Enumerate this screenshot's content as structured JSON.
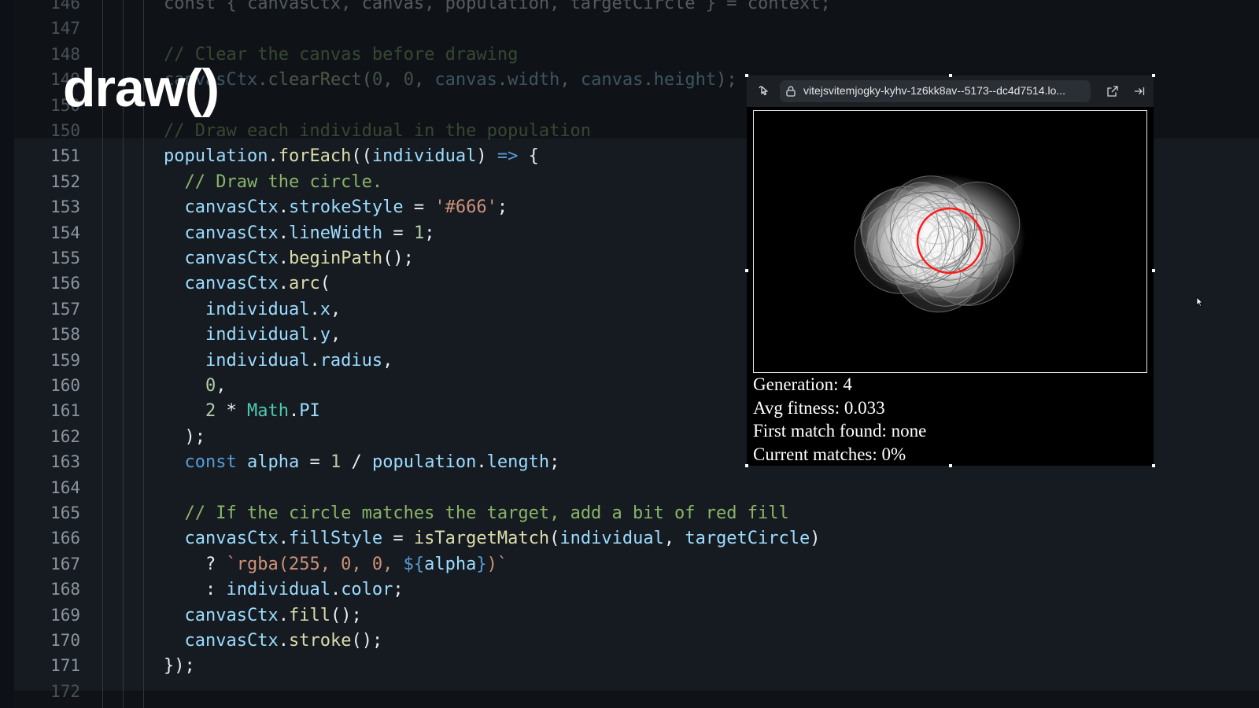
{
  "slide_title": "draw()",
  "editor": {
    "lines": [
      {
        "num": "146",
        "tokens": [
          [
            "p",
            "const { canvasCtx, canvas, population, targetCircle } = context;"
          ]
        ]
      },
      {
        "num": "147",
        "tokens": [
          [
            "p",
            ""
          ]
        ]
      },
      {
        "num": "148",
        "tokens": [
          [
            "com",
            "// Clear the canvas before drawing"
          ]
        ]
      },
      {
        "num": "149",
        "tokens": [
          [
            "id",
            "canvasCtx"
          ],
          [
            "p",
            "."
          ],
          [
            "fn",
            "clearRect"
          ],
          [
            "p",
            "("
          ],
          [
            "num",
            "0"
          ],
          [
            "p",
            ", "
          ],
          [
            "num",
            "0"
          ],
          [
            "p",
            ", "
          ],
          [
            "id",
            "canvas"
          ],
          [
            "p",
            "."
          ],
          [
            "id",
            "width"
          ],
          [
            "p",
            ", "
          ],
          [
            "id",
            "canvas"
          ],
          [
            "p",
            "."
          ],
          [
            "id",
            "height"
          ],
          [
            "p",
            ");"
          ]
        ]
      },
      {
        "num": "150",
        "tokens": [
          [
            "p",
            ""
          ]
        ]
      },
      {
        "num": "150",
        "tokens": [
          [
            "com",
            "// Draw each individual in the population"
          ]
        ]
      },
      {
        "num": "151",
        "tokens": [
          [
            "id",
            "population"
          ],
          [
            "p",
            "."
          ],
          [
            "fn",
            "forEach"
          ],
          [
            "p",
            "(("
          ],
          [
            "id",
            "individual"
          ],
          [
            "p",
            ") "
          ],
          [
            "kw",
            "=>"
          ],
          [
            "p",
            " {"
          ]
        ]
      },
      {
        "num": "152",
        "tokens": [
          [
            "p",
            "  "
          ],
          [
            "com",
            "// Draw the circle."
          ]
        ]
      },
      {
        "num": "153",
        "tokens": [
          [
            "p",
            "  "
          ],
          [
            "id",
            "canvasCtx"
          ],
          [
            "p",
            "."
          ],
          [
            "id",
            "strokeStyle"
          ],
          [
            "p",
            " = "
          ],
          [
            "str",
            "'#666'"
          ],
          [
            "p",
            ";"
          ]
        ]
      },
      {
        "num": "154",
        "tokens": [
          [
            "p",
            "  "
          ],
          [
            "id",
            "canvasCtx"
          ],
          [
            "p",
            "."
          ],
          [
            "id",
            "lineWidth"
          ],
          [
            "p",
            " = "
          ],
          [
            "num",
            "1"
          ],
          [
            "p",
            ";"
          ]
        ]
      },
      {
        "num": "155",
        "tokens": [
          [
            "p",
            "  "
          ],
          [
            "id",
            "canvasCtx"
          ],
          [
            "p",
            "."
          ],
          [
            "fn",
            "beginPath"
          ],
          [
            "p",
            "();"
          ]
        ]
      },
      {
        "num": "156",
        "tokens": [
          [
            "p",
            "  "
          ],
          [
            "id",
            "canvasCtx"
          ],
          [
            "p",
            "."
          ],
          [
            "fn",
            "arc"
          ],
          [
            "p",
            "("
          ]
        ]
      },
      {
        "num": "157",
        "tokens": [
          [
            "p",
            "    "
          ],
          [
            "id",
            "individual"
          ],
          [
            "p",
            "."
          ],
          [
            "id",
            "x"
          ],
          [
            "p",
            ","
          ]
        ]
      },
      {
        "num": "158",
        "tokens": [
          [
            "p",
            "    "
          ],
          [
            "id",
            "individual"
          ],
          [
            "p",
            "."
          ],
          [
            "id",
            "y"
          ],
          [
            "p",
            ","
          ]
        ]
      },
      {
        "num": "159",
        "tokens": [
          [
            "p",
            "    "
          ],
          [
            "id",
            "individual"
          ],
          [
            "p",
            "."
          ],
          [
            "id",
            "radius"
          ],
          [
            "p",
            ","
          ]
        ]
      },
      {
        "num": "160",
        "tokens": [
          [
            "p",
            "    "
          ],
          [
            "num",
            "0"
          ],
          [
            "p",
            ","
          ]
        ]
      },
      {
        "num": "161",
        "tokens": [
          [
            "p",
            "    "
          ],
          [
            "num",
            "2"
          ],
          [
            "p",
            " * "
          ],
          [
            "type",
            "Math"
          ],
          [
            "p",
            "."
          ],
          [
            "id",
            "PI"
          ]
        ]
      },
      {
        "num": "162",
        "tokens": [
          [
            "p",
            "  );"
          ]
        ]
      },
      {
        "num": "163",
        "tokens": [
          [
            "p",
            "  "
          ],
          [
            "kw",
            "const"
          ],
          [
            "p",
            " "
          ],
          [
            "id",
            "alpha"
          ],
          [
            "p",
            " = "
          ],
          [
            "num",
            "1"
          ],
          [
            "p",
            " / "
          ],
          [
            "id",
            "population"
          ],
          [
            "p",
            "."
          ],
          [
            "id",
            "length"
          ],
          [
            "p",
            ";"
          ]
        ]
      },
      {
        "num": "164",
        "tokens": [
          [
            "p",
            ""
          ]
        ]
      },
      {
        "num": "165",
        "tokens": [
          [
            "p",
            "  "
          ],
          [
            "com",
            "// If the circle matches the target, add a bit of red fill"
          ]
        ]
      },
      {
        "num": "166",
        "tokens": [
          [
            "p",
            "  "
          ],
          [
            "id",
            "canvasCtx"
          ],
          [
            "p",
            "."
          ],
          [
            "id",
            "fillStyle"
          ],
          [
            "p",
            " = "
          ],
          [
            "fn",
            "isTargetMatch"
          ],
          [
            "p",
            "("
          ],
          [
            "id",
            "individual"
          ],
          [
            "p",
            ", "
          ],
          [
            "id",
            "targetCircle"
          ],
          [
            "p",
            ")"
          ]
        ]
      },
      {
        "num": "167",
        "tokens": [
          [
            "p",
            "    ? "
          ],
          [
            "str",
            "`rgba(255, 0, 0, "
          ],
          [
            "kw",
            "${"
          ],
          [
            "id",
            "alpha"
          ],
          [
            "kw",
            "}"
          ],
          [
            "str",
            ")`"
          ]
        ]
      },
      {
        "num": "168",
        "tokens": [
          [
            "p",
            "    : "
          ],
          [
            "id",
            "individual"
          ],
          [
            "p",
            "."
          ],
          [
            "id",
            "color"
          ],
          [
            "p",
            ";"
          ]
        ]
      },
      {
        "num": "169",
        "tokens": [
          [
            "p",
            "  "
          ],
          [
            "id",
            "canvasCtx"
          ],
          [
            "p",
            "."
          ],
          [
            "fn",
            "fill"
          ],
          [
            "p",
            "();"
          ]
        ]
      },
      {
        "num": "170",
        "tokens": [
          [
            "p",
            "  "
          ],
          [
            "id",
            "canvasCtx"
          ],
          [
            "p",
            "."
          ],
          [
            "fn",
            "stroke"
          ],
          [
            "p",
            "();"
          ]
        ]
      },
      {
        "num": "171",
        "tokens": [
          [
            "p",
            "});"
          ]
        ]
      },
      {
        "num": "172",
        "tokens": [
          [
            "p",
            ""
          ]
        ]
      }
    ]
  },
  "preview": {
    "url": "vitejsvitemjogky-kyhv-1z6kk8av--5173--dc4d7514.lo...",
    "icons": {
      "left": "cursor-pointer-icon",
      "lock": "lock-icon",
      "open": "open-external-icon",
      "collapse": "collapse-right-icon"
    },
    "stats": {
      "generation": "Generation: 4",
      "avg_fitness": "Avg fitness: 0.033",
      "first_match": "First match found: none",
      "current_matches": "Current matches: 0%"
    }
  },
  "colors": {
    "keyword": "#569cd6",
    "string": "#ce9178",
    "comment": "#8ab567",
    "function": "#dcdcaa",
    "identifier": "#9cdcfe",
    "number": "#b5cea8",
    "target": "#ff1a1a"
  }
}
